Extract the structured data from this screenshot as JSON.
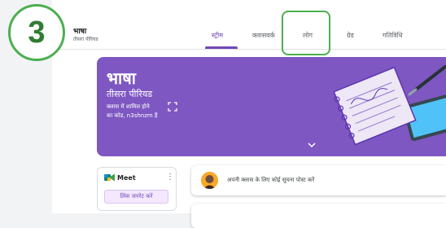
{
  "class_header": {
    "title": "भाषा",
    "subtitle": "तीसरा पीरियड"
  },
  "tabs": [
    {
      "label": "स्ट्रीम",
      "active": true
    },
    {
      "label": "क्लासवर्क",
      "active": false
    },
    {
      "label": "लोग",
      "active": false
    },
    {
      "label": "ग्रेड",
      "active": false
    },
    {
      "label": "गतिविधि",
      "active": false
    }
  ],
  "step": {
    "number": "3"
  },
  "banner": {
    "title": "भाषा",
    "subtitle": "तीसरा पीरियड",
    "code_line1": "क्लास में शामिल होने",
    "code_line2": "का कोड, n3shnzm है",
    "color": "#7e57c2"
  },
  "meet": {
    "label": "Meet",
    "button": "लिंक जनरेट करें"
  },
  "post": {
    "placeholder": "अपनी क्लास के लिए कोई सूचना पोस्ट करें"
  },
  "colors": {
    "accent": "#7248b9",
    "highlight": "#4caf50"
  }
}
